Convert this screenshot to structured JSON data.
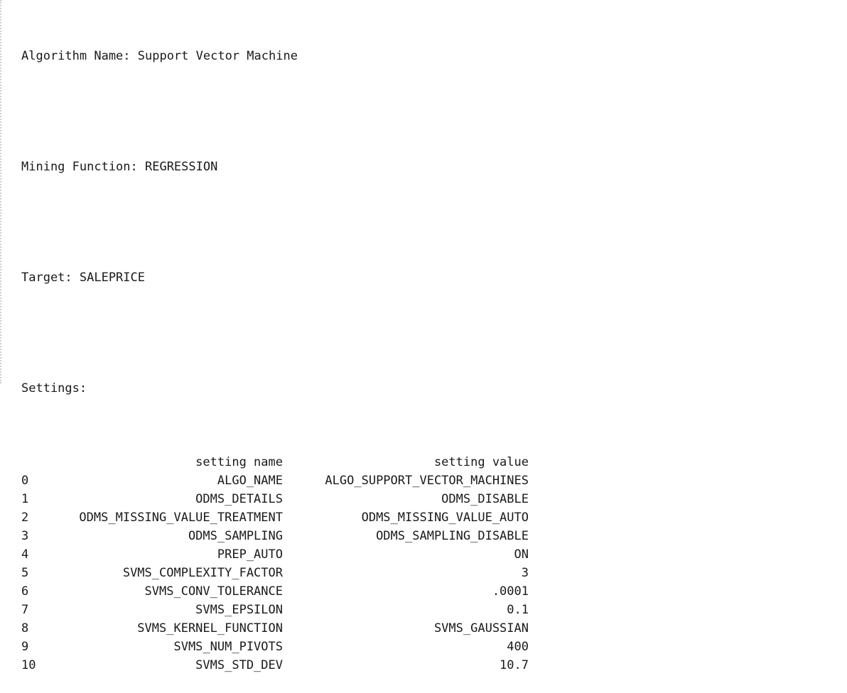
{
  "output": {
    "algorithm_line": "Algorithm Name: Support Vector Machine",
    "mining_function_line": "Mining Function: REGRESSION",
    "target_line": "Target: SALEPRICE",
    "settings_heading": "Settings:"
  },
  "settings_table": {
    "columns": [
      "setting name",
      "setting value"
    ],
    "rows": [
      {
        "index": "0",
        "name": "ALGO_NAME",
        "value": "ALGO_SUPPORT_VECTOR_MACHINES"
      },
      {
        "index": "1",
        "name": "ODMS_DETAILS",
        "value": "ODMS_DISABLE"
      },
      {
        "index": "2",
        "name": "ODMS_MISSING_VALUE_TREATMENT",
        "value": "ODMS_MISSING_VALUE_AUTO"
      },
      {
        "index": "3",
        "name": "ODMS_SAMPLING",
        "value": "ODMS_SAMPLING_DISABLE"
      },
      {
        "index": "4",
        "name": "PREP_AUTO",
        "value": "ON"
      },
      {
        "index": "5",
        "name": "SVMS_COMPLEXITY_FACTOR",
        "value": "3"
      },
      {
        "index": "6",
        "name": "SVMS_CONV_TOLERANCE",
        "value": ".0001"
      },
      {
        "index": "7",
        "name": "SVMS_EPSILON",
        "value": "0.1"
      },
      {
        "index": "8",
        "name": "SVMS_KERNEL_FUNCTION",
        "value": "SVMS_GAUSSIAN"
      },
      {
        "index": "9",
        "name": "SVMS_NUM_PIVOTS",
        "value": "400"
      },
      {
        "index": "10",
        "name": "SVMS_STD_DEV",
        "value": "10.7"
      }
    ]
  }
}
